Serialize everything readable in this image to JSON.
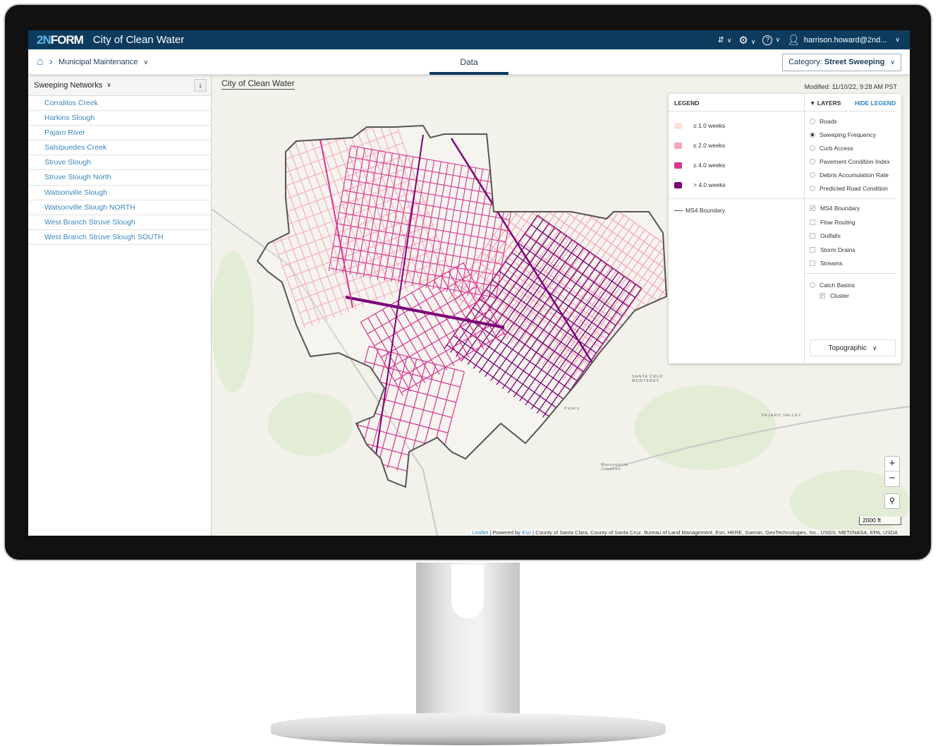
{
  "header": {
    "logo": "2NFORM",
    "logo_prefix": "2N",
    "logo_suffix": "FORM",
    "app_title": "City of Clean Water",
    "user": "harrison.howard@2nd..."
  },
  "subbar": {
    "breadcrumb": "Municipal Maintenance",
    "tab": "Data",
    "category_label": "Category:",
    "category_value": "Street Sweeping"
  },
  "sidebar": {
    "title": "Sweeping Networks",
    "items": [
      "Corralitos Creek",
      "Harkins Slough",
      "Pajaro River",
      "Salsipuedes Creek",
      "Struve Slough",
      "Struve Slough North",
      "Watsonville Slough",
      "Watsonville Slough NORTH",
      "West Branch Struve Slough",
      "West Branch Struve Slough SOUTH"
    ]
  },
  "map": {
    "title": "City of Clean Water",
    "modified": "Modified: 11/10/22, 9:28 AM PST",
    "scale": "2000 ft",
    "attribution": {
      "leaflet": "Leaflet",
      "powered": "Powered by",
      "esri": "Esri",
      "sources": "County of Santa Clara, County of Santa Cruz, Bureau of Land Management, Esri, HERE, Garmin, GeoTechnologies, Inc., USGS, METI/NASA, EPA, USDA"
    },
    "labels": {
      "valley": "PAJARO VALLEY",
      "pajaro": "Pajaro",
      "junction": "Watsonville Junction",
      "montery": "SANTA CRUZ MONTEREY"
    },
    "zoom_in": "+",
    "zoom_out": "−"
  },
  "legend": {
    "title": "LEGEND",
    "layers_title": "LAYERS",
    "hide": "HIDE LEGEND",
    "swatches": [
      {
        "label": "≤ 1.0 weeks",
        "color": "#fde3dc"
      },
      {
        "label": "≤ 2.0 weeks",
        "color": "#f8a3b4"
      },
      {
        "label": "≤ 4.0 weeks",
        "color": "#d83592"
      },
      {
        "label": "> 4.0 weeks",
        "color": "#7a0177"
      }
    ],
    "boundary": "MS4 Boundary",
    "radio_layers": [
      {
        "label": "Roads",
        "selected": false
      },
      {
        "label": "Sweeping Frequency",
        "selected": true
      },
      {
        "label": "Curb Access",
        "selected": false
      },
      {
        "label": "Pavement Condition Index",
        "selected": false
      },
      {
        "label": "Debris Accumulation Rate",
        "selected": false
      },
      {
        "label": "Predicted Road Condition",
        "selected": false
      }
    ],
    "check_layers": [
      {
        "label": "MS4 Boundary",
        "checked": true
      },
      {
        "label": "Flow Routing",
        "checked": false
      },
      {
        "label": "Outfalls",
        "checked": false
      },
      {
        "label": "Storm Drains",
        "checked": false
      },
      {
        "label": "Streams",
        "checked": false
      }
    ],
    "catch_basins": "Catch Basins",
    "cluster": "Cluster",
    "cluster_checked": true,
    "basemap": "Topographic"
  }
}
